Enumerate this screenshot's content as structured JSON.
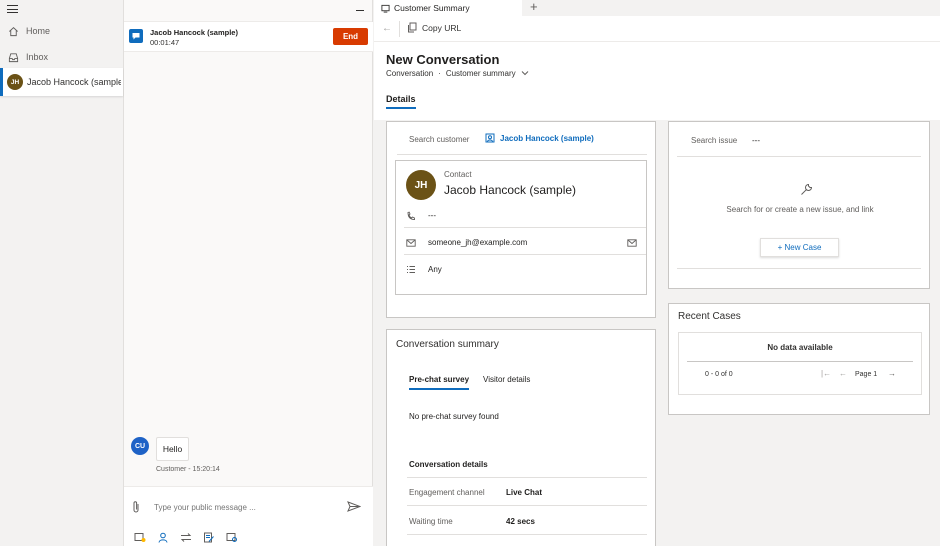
{
  "nav": {
    "items": [
      {
        "label": "Home"
      },
      {
        "label": "Inbox"
      },
      {
        "label": "Jacob Hancock (sample)",
        "initials": "JH"
      }
    ]
  },
  "chat": {
    "session": {
      "name": "Jacob Hancock (sample)",
      "timer": "00:01:47",
      "end_label": "End"
    },
    "message": {
      "initials": "CU",
      "text": "Hello",
      "meta": "Customer - 15:20:14"
    },
    "compose_placeholder": "Type your public message ..."
  },
  "tabs": {
    "active_label": "Customer Summary",
    "copy_url_label": "Copy URL"
  },
  "form": {
    "title": "New Conversation",
    "entity": "Conversation",
    "form_name": "Customer summary",
    "details_tab": "Details"
  },
  "customer": {
    "search_label": "Search customer",
    "selected_name": "Jacob Hancock (sample)",
    "contact": {
      "type_label": "Contact",
      "initials": "JH",
      "name": "Jacob Hancock (sample)",
      "phone": "---",
      "email": "someone_jh@example.com",
      "preference": "Any"
    }
  },
  "issue": {
    "search_label": "Search issue",
    "value": "---",
    "hint": "Search for or create a new issue, and link",
    "new_case_label": "+ New Case"
  },
  "recent_cases": {
    "title": "Recent Cases",
    "empty_text": "No data available",
    "range_text": "0 - 0 of 0",
    "page_text": "Page 1"
  },
  "summary": {
    "title": "Conversation summary",
    "tabs": [
      {
        "label": "Pre-chat survey"
      },
      {
        "label": "Visitor details"
      }
    ],
    "empty_text": "No pre-chat survey found",
    "details_heading": "Conversation details",
    "rows": [
      {
        "label": "Engagement channel",
        "value": "Live Chat"
      },
      {
        "label": "Waiting time",
        "value": "42 secs"
      }
    ]
  },
  "colors": {
    "accent": "#0f6cbd",
    "end_button": "#d83b01",
    "contact_avatar": "#6b5216",
    "customer_avatar": "#1e62c6"
  }
}
